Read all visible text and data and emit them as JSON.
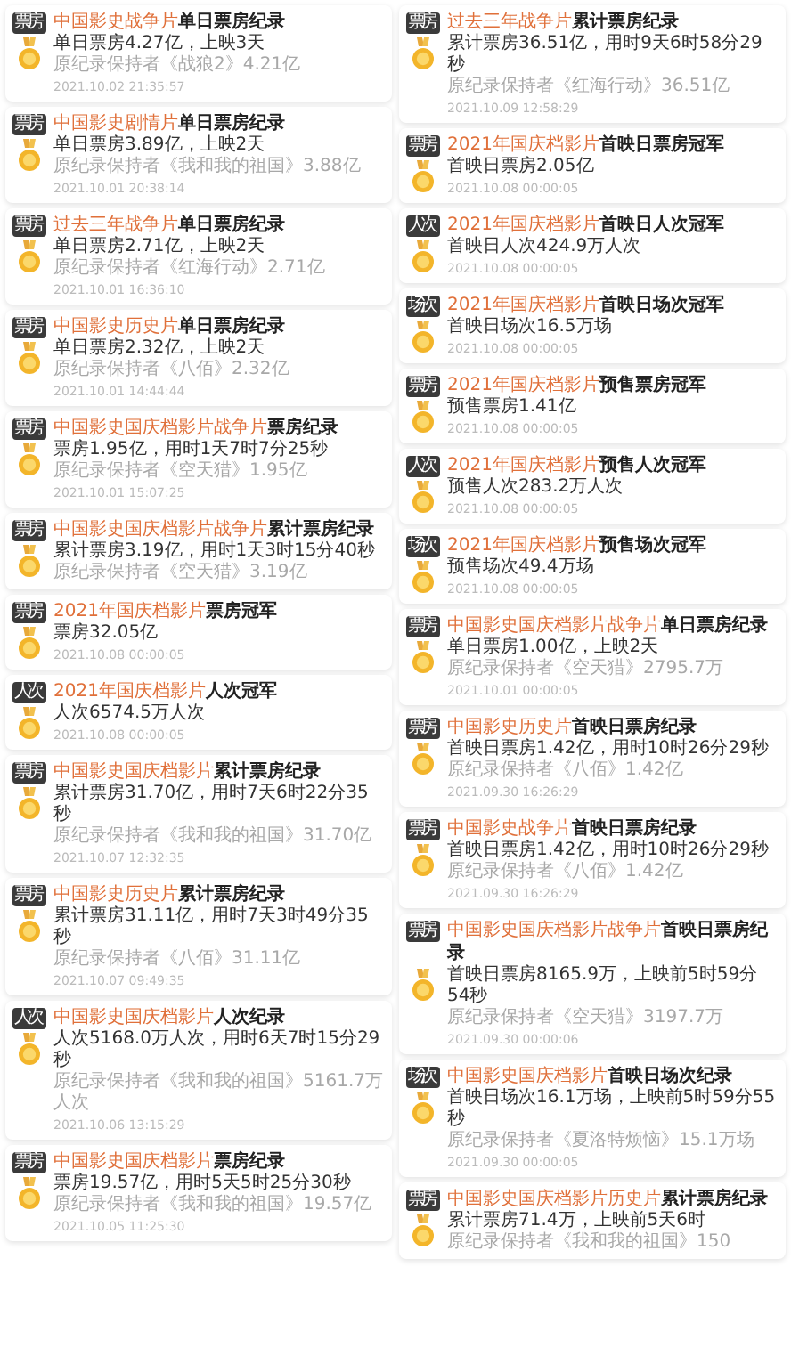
{
  "columns": [
    {
      "cards": [
        {
          "tag": "票房",
          "title_highlight": "中国影史战争片",
          "title_rest": "单日票房纪录",
          "value": "单日票房4.27亿，上映3天",
          "record": "原纪录保持者《战狼2》4.21亿",
          "time": "2021.10.02 21:35:57"
        },
        {
          "tag": "票房",
          "title_highlight": "中国影史剧情片",
          "title_rest": "单日票房纪录",
          "value": "单日票房3.89亿，上映2天",
          "record": "原纪录保持者《我和我的祖国》3.88亿",
          "time": "2021.10.01 20:38:14"
        },
        {
          "tag": "票房",
          "title_highlight": "过去三年战争片",
          "title_rest": "单日票房纪录",
          "value": "单日票房2.71亿，上映2天",
          "record": "原纪录保持者《红海行动》2.71亿",
          "time": "2021.10.01 16:36:10"
        },
        {
          "tag": "票房",
          "title_highlight": "中国影史历史片",
          "title_rest": "单日票房纪录",
          "value": "单日票房2.32亿，上映2天",
          "record": "原纪录保持者《八佰》2.32亿",
          "time": "2021.10.01 14:44:44"
        },
        {
          "tag": "票房",
          "title_highlight": "中国影史国庆档影片战争片",
          "title_rest": "票房纪录",
          "value": "票房1.95亿，用时1天7时7分25秒",
          "record": "原纪录保持者《空天猎》1.95亿",
          "time": "2021.10.01 15:07:25"
        },
        {
          "tag": "票房",
          "title_highlight": "中国影史国庆档影片战争片",
          "title_rest": "累计票房纪录",
          "value": "累计票房3.19亿，用时1天3时15分40秒",
          "record": "原纪录保持者《空天猎》3.19亿"
        },
        {
          "tag": "票房",
          "title_highlight": "2021年国庆档影片",
          "title_rest": "票房冠军",
          "value": "票房32.05亿",
          "time": "2021.10.08 00:00:05"
        },
        {
          "tag": "人次",
          "title_highlight": "2021年国庆档影片",
          "title_rest": "人次冠军",
          "value": "人次6574.5万人次",
          "time": "2021.10.08 00:00:05"
        },
        {
          "tag": "票房",
          "title_highlight": "中国影史国庆档影片",
          "title_rest": "累计票房纪录",
          "value": "累计票房31.70亿，用时7天6时22分35秒",
          "record": "原纪录保持者《我和我的祖国》31.70亿",
          "time": "2021.10.07 12:32:35"
        },
        {
          "tag": "票房",
          "title_highlight": "中国影史历史片",
          "title_rest": "累计票房纪录",
          "value": "累计票房31.11亿，用时7天3时49分35秒",
          "record": "原纪录保持者《八佰》31.11亿",
          "time": "2021.10.07 09:49:35"
        },
        {
          "tag": "人次",
          "title_highlight": "中国影史国庆档影片",
          "title_rest": "人次纪录",
          "value": "人次5168.0万人次，用时6天7时15分29秒",
          "record": "原纪录保持者《我和我的祖国》5161.7万人次",
          "time": "2021.10.06 13:15:29"
        },
        {
          "tag": "票房",
          "title_highlight": "中国影史国庆档影片",
          "title_rest": "票房纪录",
          "value": "票房19.57亿，用时5天5时25分30秒",
          "record": "原纪录保持者《我和我的祖国》19.57亿",
          "time": "2021.10.05 11:25:30"
        }
      ]
    },
    {
      "cards": [
        {
          "tag": "票房",
          "title_highlight": "过去三年战争片",
          "title_rest": "累计票房纪录",
          "value": "累计票房36.51亿，用时9天6时58分29秒",
          "record": "原纪录保持者《红海行动》36.51亿",
          "time": "2021.10.09 12:58:29"
        },
        {
          "tag": "票房",
          "title_highlight": "2021年国庆档影片",
          "title_rest": "首映日票房冠军",
          "value": "首映日票房2.05亿",
          "time": "2021.10.08 00:00:05"
        },
        {
          "tag": "人次",
          "title_highlight": "2021年国庆档影片",
          "title_rest": "首映日人次冠军",
          "value": "首映日人次424.9万人次",
          "time": "2021.10.08 00:00:05"
        },
        {
          "tag": "场次",
          "title_highlight": "2021年国庆档影片",
          "title_rest": "首映日场次冠军",
          "value": "首映日场次16.5万场",
          "time": "2021.10.08 00:00:05"
        },
        {
          "tag": "票房",
          "title_highlight": "2021年国庆档影片",
          "title_rest": "预售票房冠军",
          "value": "预售票房1.41亿",
          "time": "2021.10.08 00:00:05"
        },
        {
          "tag": "人次",
          "title_highlight": "2021年国庆档影片",
          "title_rest": "预售人次冠军",
          "value": "预售人次283.2万人次",
          "time": "2021.10.08 00:00:05"
        },
        {
          "tag": "场次",
          "title_highlight": "2021年国庆档影片",
          "title_rest": "预售场次冠军",
          "value": "预售场次49.4万场",
          "time": "2021.10.08 00:00:05"
        },
        {
          "tag": "票房",
          "title_highlight": "中国影史国庆档影片战争片",
          "title_rest": "单日票房纪录",
          "value": "单日票房1.00亿，上映2天",
          "record": "原纪录保持者《空天猎》2795.7万",
          "time": "2021.10.01 00:00:05"
        },
        {
          "tag": "票房",
          "title_highlight": "中国影史历史片",
          "title_rest": "首映日票房纪录",
          "value": "首映日票房1.42亿，用时10时26分29秒",
          "record": "原纪录保持者《八佰》1.42亿",
          "time": "2021.09.30 16:26:29"
        },
        {
          "tag": "票房",
          "title_highlight": "中国影史战争片",
          "title_rest": "首映日票房纪录",
          "value": "首映日票房1.42亿，用时10时26分29秒",
          "record": "原纪录保持者《八佰》1.42亿",
          "time": "2021.09.30 16:26:29"
        },
        {
          "tag": "票房",
          "title_highlight": "中国影史国庆档影片战争片",
          "title_rest": "首映日票房纪录",
          "value": "首映日票房8165.9万，上映前5时59分54秒",
          "record": "原纪录保持者《空天猎》3197.7万",
          "time": "2021.09.30 00:00:06"
        },
        {
          "tag": "场次",
          "title_highlight": "中国影史国庆档影片",
          "title_rest": "首映日场次纪录",
          "value": "首映日场次16.1万场，上映前5时59分55秒",
          "record": "原纪录保持者《夏洛特烦恼》15.1万场",
          "time": "2021.09.30 00:00:05"
        },
        {
          "tag": "票房",
          "title_highlight": "中国影史国庆档影片历史片",
          "title_rest": "累计票房纪录",
          "value": "累计票房71.4万，上映前5天6时",
          "record": "原纪录保持者《我和我的祖国》150"
        }
      ]
    }
  ]
}
